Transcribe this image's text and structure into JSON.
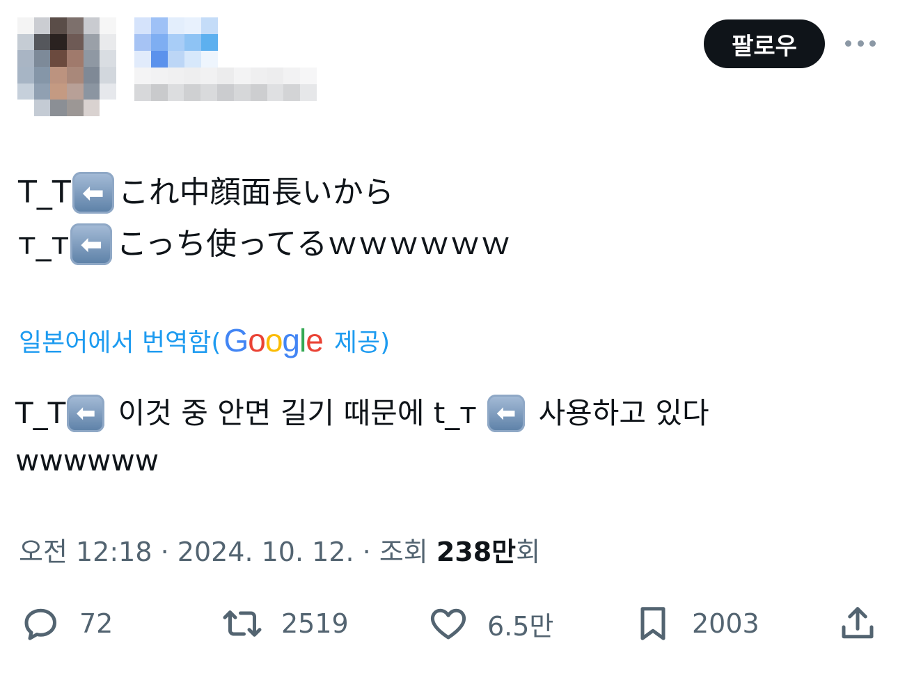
{
  "header": {
    "follow_label": "팔로우"
  },
  "tweet": {
    "original_lines": [
      {
        "prefix": "T_T",
        "key": "⬅",
        "text": "これ中顔面長いから"
      },
      {
        "prefix": "ᴛ_ᴛ",
        "key": "⬅",
        "text": "こっち使ってるｗｗｗｗｗｗ"
      }
    ],
    "translation_link": {
      "prefix": "일본어에서 번역함(",
      "provider": "Google",
      "suffix": "제공)"
    },
    "translated_line1": {
      "part1": "T_T",
      "key": "⬅",
      "part2": " 이것 중 안면 길기 때문에 t_ᴛ ",
      "part3": " 사용하고 있다"
    },
    "translated_line2": "wwwwww"
  },
  "meta": {
    "time": "오전 12:18",
    "sep": " · ",
    "date": "2024. 10. 12.",
    "views_prefix": "조회 ",
    "views_count": "238만",
    "views_suffix": "회"
  },
  "actions": {
    "replies": "72",
    "retweets": "2519",
    "likes": "6.5만",
    "bookmarks": "2003"
  },
  "icons": {
    "reply": "comment-icon",
    "retweet": "retweet-icon",
    "like": "heart-icon",
    "bookmark": "bookmark-icon",
    "share": "share-icon",
    "more": "more-icon"
  }
}
